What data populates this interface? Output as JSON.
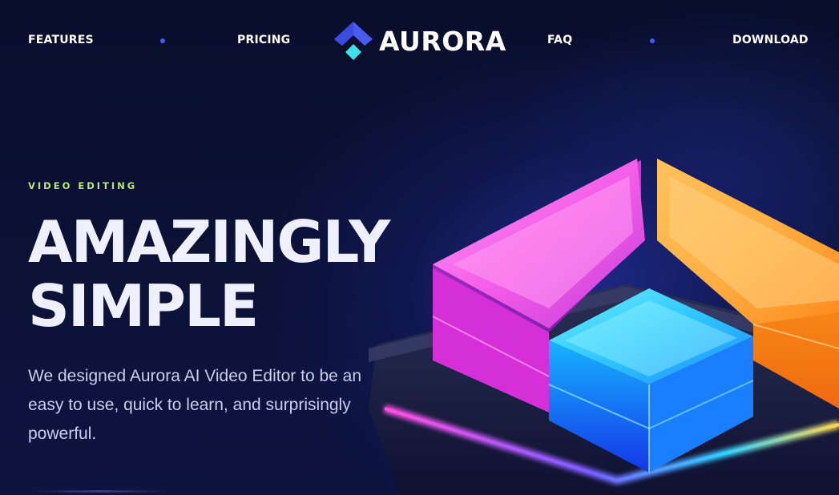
{
  "nav": {
    "left_items": [
      "FEATURES",
      "PRICING"
    ],
    "right_items": [
      "FAQ",
      "DOWNLOAD"
    ],
    "brand": "AURORA",
    "dot_color": "#3d5cff"
  },
  "hero": {
    "eyebrow": "VIDEO EDITING",
    "headline_line1": "AMAZINGLY",
    "headline_line2": "SIMPLE",
    "subtitle": "We designed Aurora AI Video Editor to be an easy to use, quick to learn, and surprisingly powerful."
  },
  "colors": {
    "background": "#0b1033",
    "eyebrow": "#b9e676",
    "headline": "#eef0ff",
    "logo_primary": "#4a5cf0",
    "logo_accent": "#3fe0e8",
    "tile_pink": "#ff3fe0",
    "tile_orange": "#ffa51f",
    "tile_blue": "#1fb0ff"
  },
  "icons": {
    "logo": "aurora-logo-icon",
    "illustration": "glowing-cubes-illustration"
  }
}
